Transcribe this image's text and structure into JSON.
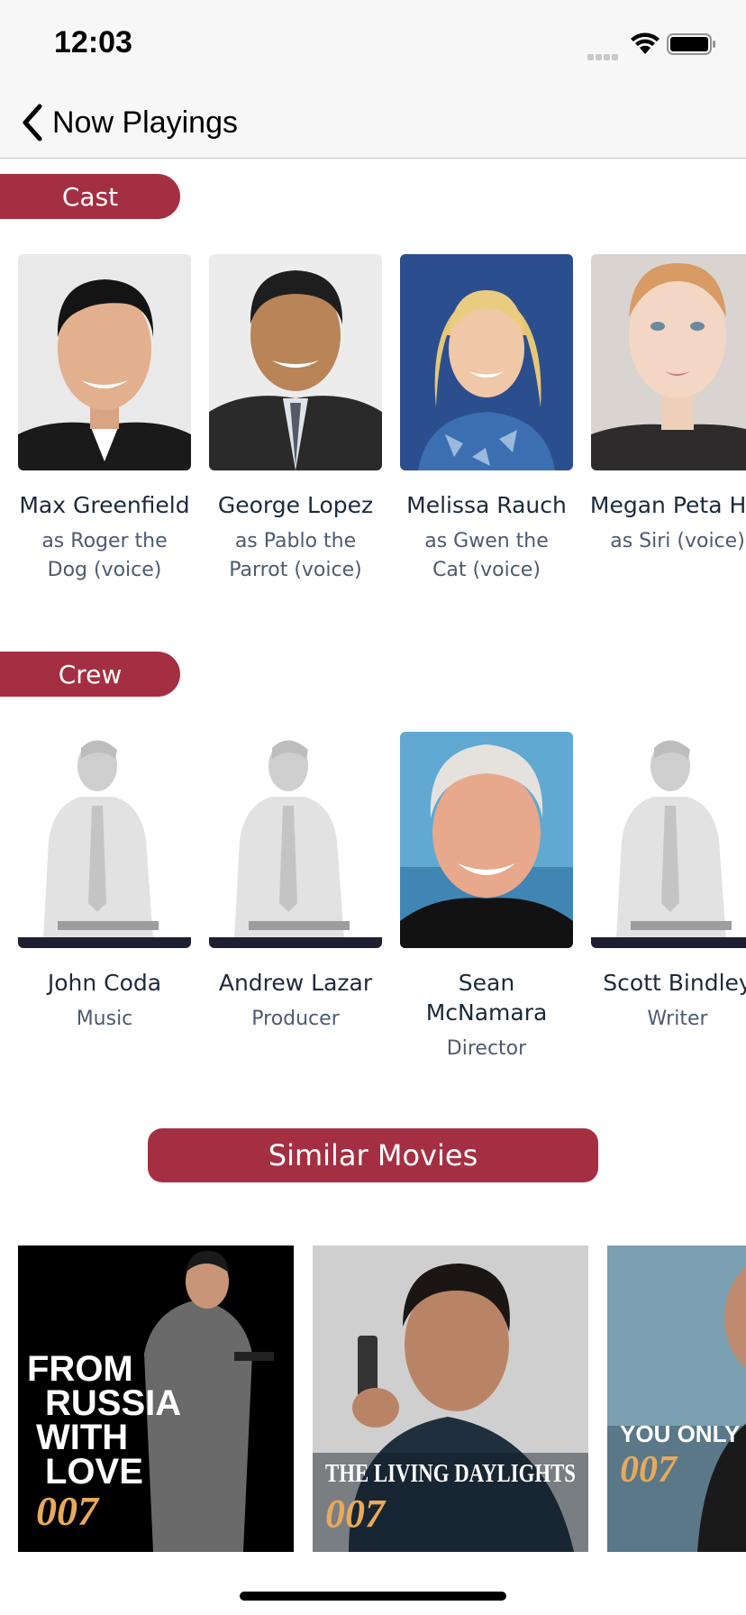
{
  "status_bar": {
    "time": "12:03"
  },
  "nav": {
    "back_label": "Now Playings"
  },
  "sections": {
    "cast": "Cast",
    "crew": "Crew",
    "similar": "Similar Movies"
  },
  "cast": [
    {
      "name": "Max Greenfield",
      "role": "as Roger the Dog (voice)"
    },
    {
      "name": "George Lopez",
      "role": "as Pablo the Parrot (voice)"
    },
    {
      "name": "Melissa Rauch",
      "role": "as Gwen the Cat (voice)"
    },
    {
      "name": "Megan Peta Hill",
      "role": "as Siri (voice)"
    }
  ],
  "crew": [
    {
      "name": "John Coda",
      "role": "Music"
    },
    {
      "name": "Andrew Lazar",
      "role": "Producer"
    },
    {
      "name": "Sean McNamara",
      "role": "Director"
    },
    {
      "name": "Scott Bindley",
      "role": "Writer"
    }
  ],
  "movies": [
    {
      "title_lines": [
        "FROM",
        "RUSSIA",
        "WITH",
        "LOVE"
      ],
      "brand": "007"
    },
    {
      "title": "THE LIVING DAYLIGHTS",
      "brand": "007"
    },
    {
      "title": "YOU ONLY LIVE TWICE",
      "brand": "007"
    }
  ],
  "colors": {
    "accent": "#a52f42",
    "text": "#1c2a3a",
    "subtext": "#4d5b6f"
  }
}
